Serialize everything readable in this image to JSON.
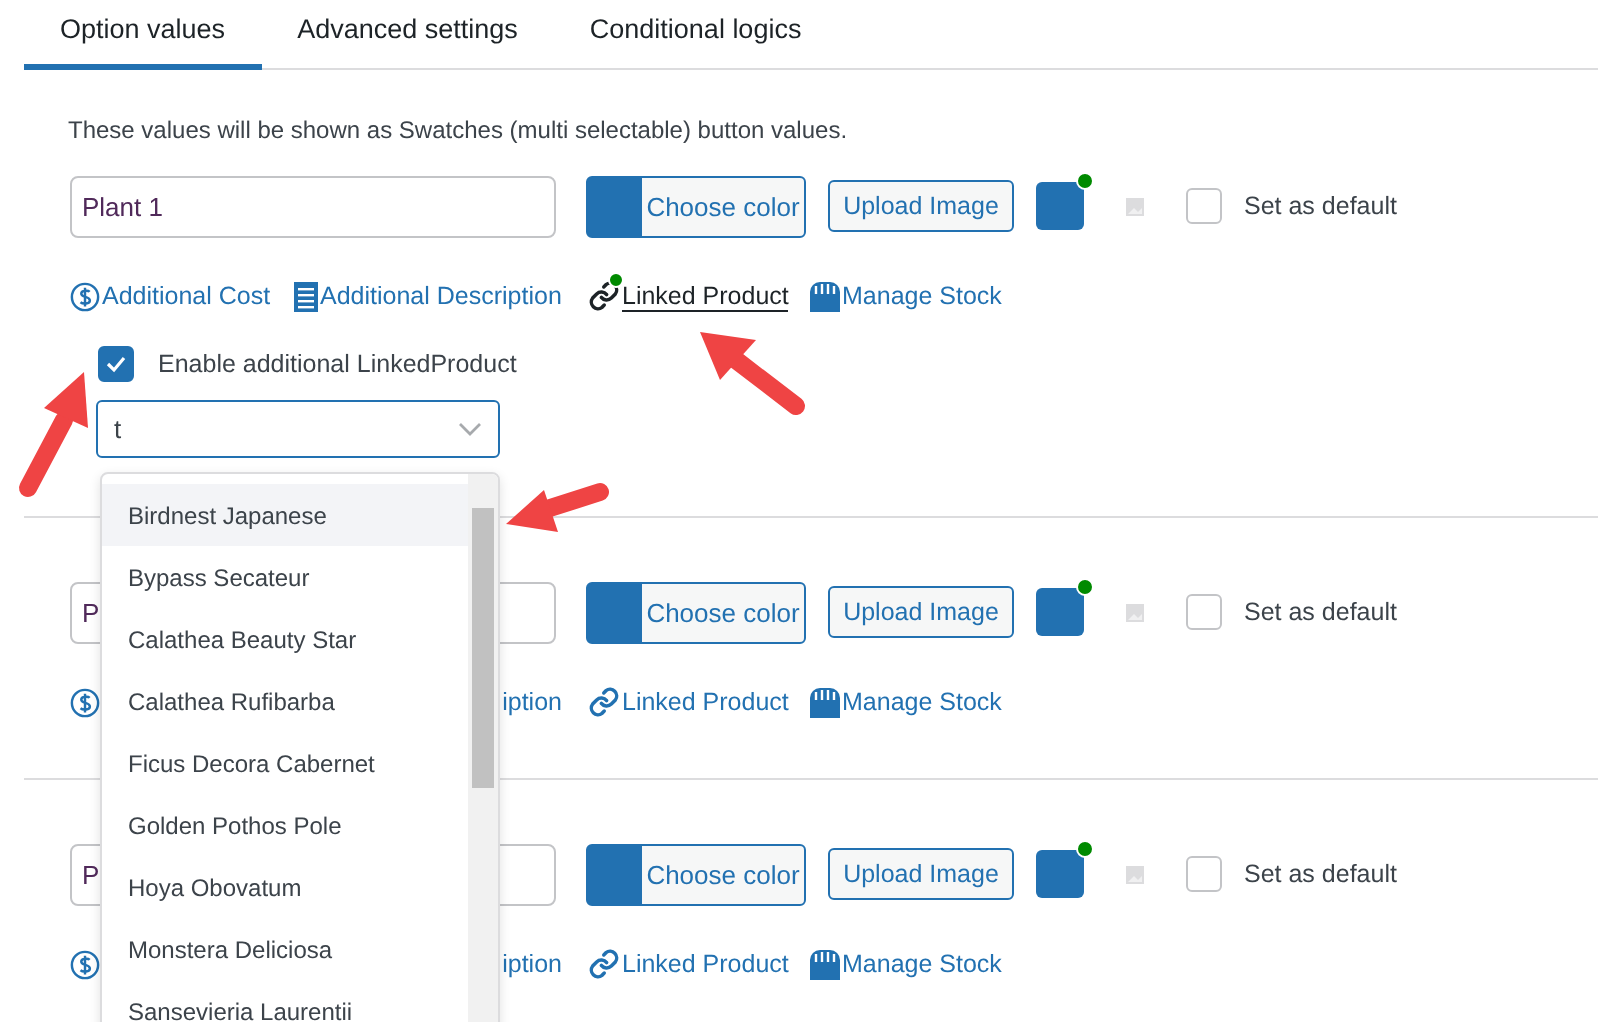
{
  "tabs": [
    {
      "label": "Option values",
      "selected": true
    },
    {
      "label": "Advanced settings",
      "selected": false
    },
    {
      "label": "Conditional logics",
      "selected": false
    }
  ],
  "description": "These values will be shown as Swatches (multi selectable) button values.",
  "options": [
    {
      "value": "Plant 1",
      "choose_color": "Choose color",
      "upload": "Upload Image",
      "is_default": false,
      "default_label": "Set as default",
      "links": [
        {
          "kind": "cost",
          "label": "Additional Cost",
          "active": false
        },
        {
          "kind": "description",
          "label": "Additional Description",
          "active": false
        },
        {
          "kind": "linked",
          "label": "Linked Product",
          "active": true
        },
        {
          "kind": "stock",
          "label": "Manage Stock",
          "active": false
        }
      ],
      "linked_panel": {
        "checkbox_label": "Enable additional LinkedProduct",
        "checked": true,
        "search": "t",
        "results": [
          {
            "label": "Birdnest Japanese",
            "selected": true
          },
          {
            "label": "Bypass Secateur",
            "selected": false
          },
          {
            "label": "Calathea Beauty Star",
            "selected": false
          },
          {
            "label": "Calathea Rufibarba",
            "selected": false
          },
          {
            "label": "Ficus Decora Cabernet",
            "selected": false
          },
          {
            "label": "Golden Pothos Pole",
            "selected": false
          },
          {
            "label": "Hoya Obovatum",
            "selected": false
          },
          {
            "label": "Monstera Deliciosa",
            "selected": false
          },
          {
            "label": "Sansevieria Laurentii",
            "selected": false
          }
        ]
      }
    },
    {
      "value": "P",
      "choose_color": "Choose color",
      "upload": "Upload Image",
      "is_default": false,
      "default_label": "Set as default",
      "links": [
        {
          "kind": "cost",
          "active": false
        },
        {
          "kind": "description",
          "label": "iption",
          "active": false
        },
        {
          "kind": "linked",
          "label": "Linked Product",
          "active": false
        },
        {
          "kind": "stock",
          "label": "Manage Stock",
          "active": false
        }
      ]
    },
    {
      "value": "P",
      "choose_color": "Choose color",
      "upload": "Upload Image",
      "is_default": false,
      "default_label": "Set as default",
      "links": [
        {
          "kind": "cost",
          "active": false
        },
        {
          "kind": "description",
          "label": "iption",
          "active": false
        },
        {
          "kind": "linked",
          "label": "Linked Product",
          "active": false
        },
        {
          "kind": "stock",
          "label": "Manage Stock",
          "active": false
        }
      ]
    }
  ]
}
